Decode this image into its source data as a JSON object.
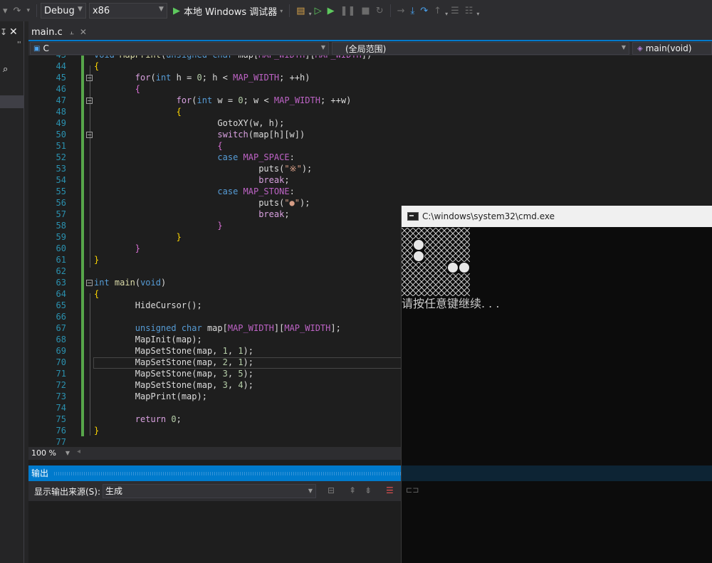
{
  "toolbar": {
    "config": "Debug",
    "platform": "x86",
    "run_label": "本地 Windows 调试器",
    "icons": [
      "undo-icon",
      "redo-icon",
      "find-icon",
      "start-icon",
      "start-without-debug-icon",
      "pause-icon",
      "stop-icon",
      "restart-icon",
      "show-next-statement-icon",
      "step-into-icon",
      "step-over-icon",
      "step-out-icon",
      "comment-icon",
      "uncomment-icon"
    ]
  },
  "left_strip": {
    "pin": "↧",
    "close": "✕",
    "more": "''",
    "search_icon": "⌕"
  },
  "tab": {
    "filename": "main.c",
    "pin": "⫠",
    "close": "✕"
  },
  "nav": {
    "project": "C",
    "scope": "(全局范围)",
    "member": "main(void)"
  },
  "editor": {
    "partial_line": "void MapPrint(unsigned char map[MAP_WIDTH][MAP_WIDTH])"
  },
  "zoom": "100 %",
  "output": {
    "title": "输出",
    "source_label": "显示输出来源(S):",
    "source_value": "生成"
  },
  "cmd": {
    "title": "C:\\windows\\system32\\cmd.exe",
    "prompt": "请按任意键继续. . .",
    "stones": [
      [
        1,
        1
      ],
      [
        2,
        1
      ],
      [
        3,
        5
      ],
      [
        3,
        4
      ]
    ]
  },
  "colors": {
    "accent": "#007acc",
    "line_number": "#2b91af",
    "keyword": "#569cd6",
    "macro": "#bd63c5",
    "change_bar": "#57a64a"
  }
}
